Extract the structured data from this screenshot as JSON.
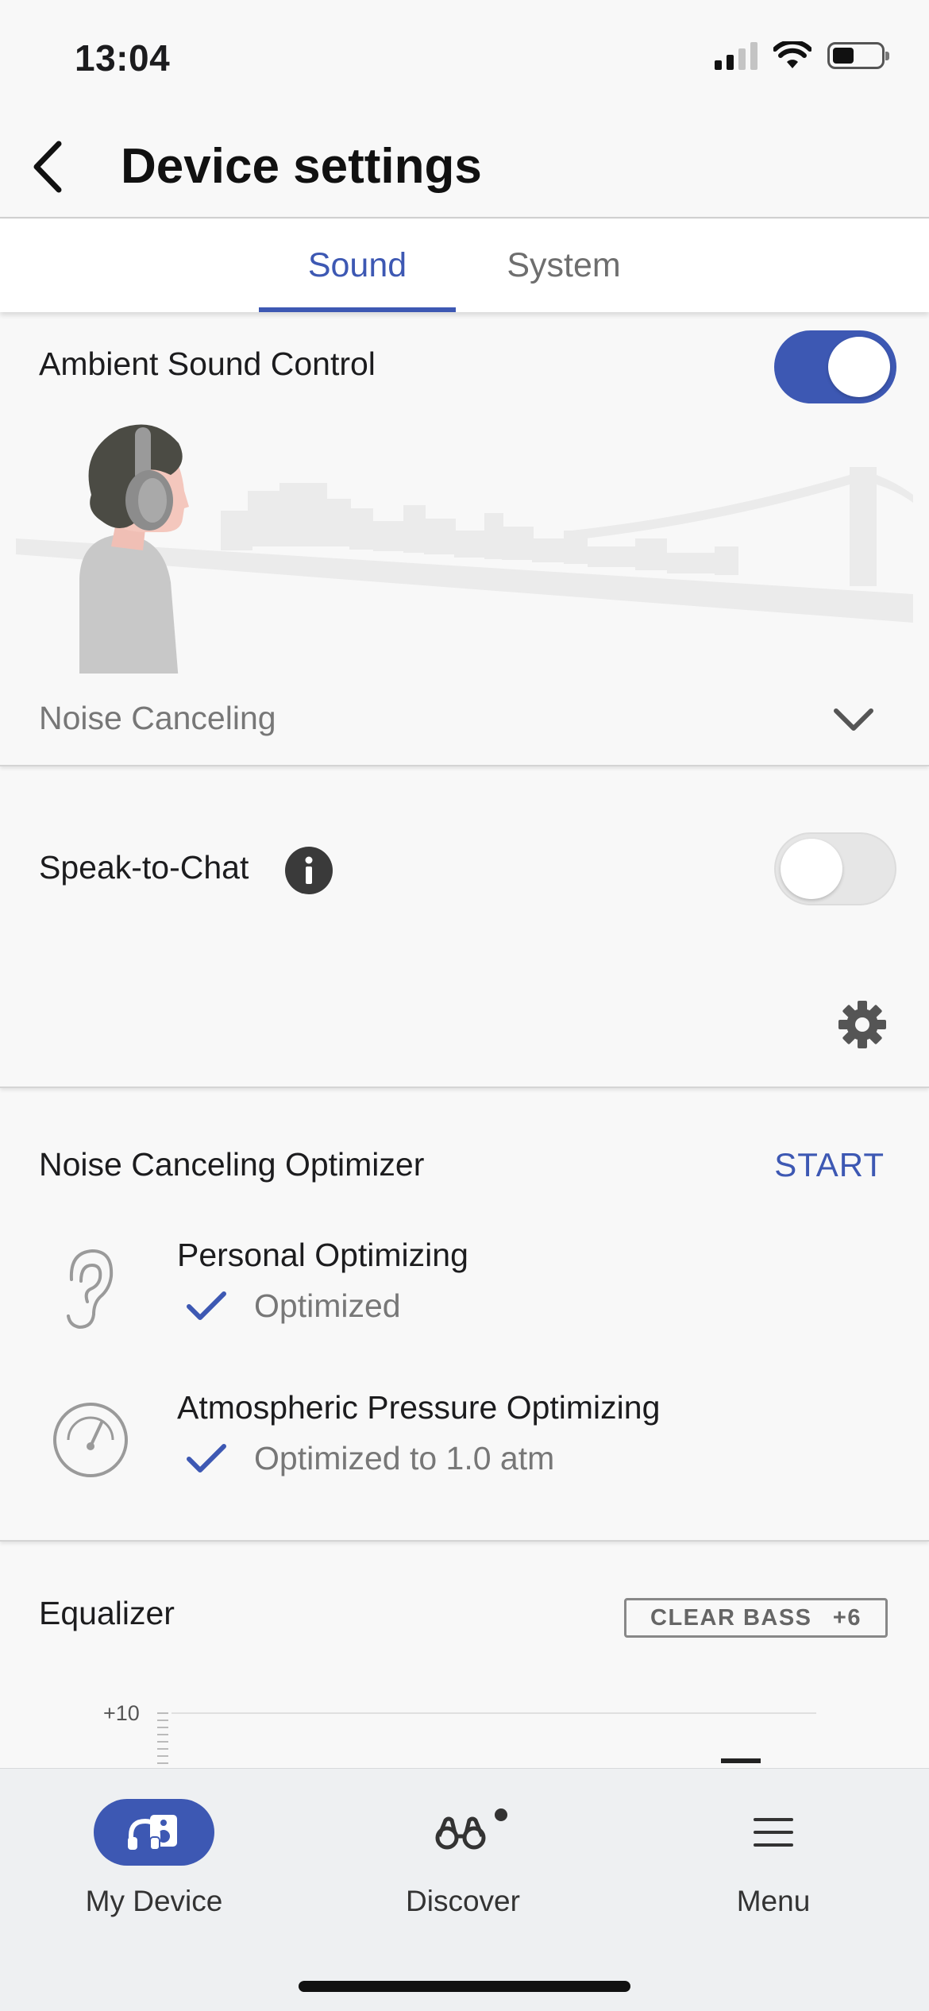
{
  "status_bar": {
    "time": "13:04"
  },
  "header": {
    "title": "Device settings"
  },
  "tabs": [
    {
      "label": "Sound",
      "active": true
    },
    {
      "label": "System",
      "active": false
    }
  ],
  "ambient": {
    "label": "Ambient Sound Control",
    "enabled": true,
    "mode_label": "Noise Canceling"
  },
  "speak_to_chat": {
    "label": "Speak-to-Chat",
    "enabled": false
  },
  "optimizer": {
    "title": "Noise Canceling Optimizer",
    "start_label": "START",
    "items": [
      {
        "title": "Personal Optimizing",
        "status": "Optimized",
        "icon": "ear-icon"
      },
      {
        "title": "Atmospheric Pressure Optimizing",
        "status": "Optimized to 1.0 atm",
        "icon": "pressure-gauge-icon"
      }
    ]
  },
  "equalizer": {
    "title": "Equalizer",
    "preset_label": "CLEAR BASS",
    "preset_value": "+6",
    "scale_top": "+10"
  },
  "bottom_nav": [
    {
      "label": "My Device",
      "icon": "headphones-speaker-icon",
      "active": true
    },
    {
      "label": "Discover",
      "icon": "binoculars-icon",
      "active": false,
      "has_dot": true
    },
    {
      "label": "Menu",
      "icon": "hamburger-menu-icon",
      "active": false
    }
  ],
  "colors": {
    "accent": "#3d58b3",
    "background": "#f8f8f8",
    "nav_background": "#eef0f2"
  }
}
